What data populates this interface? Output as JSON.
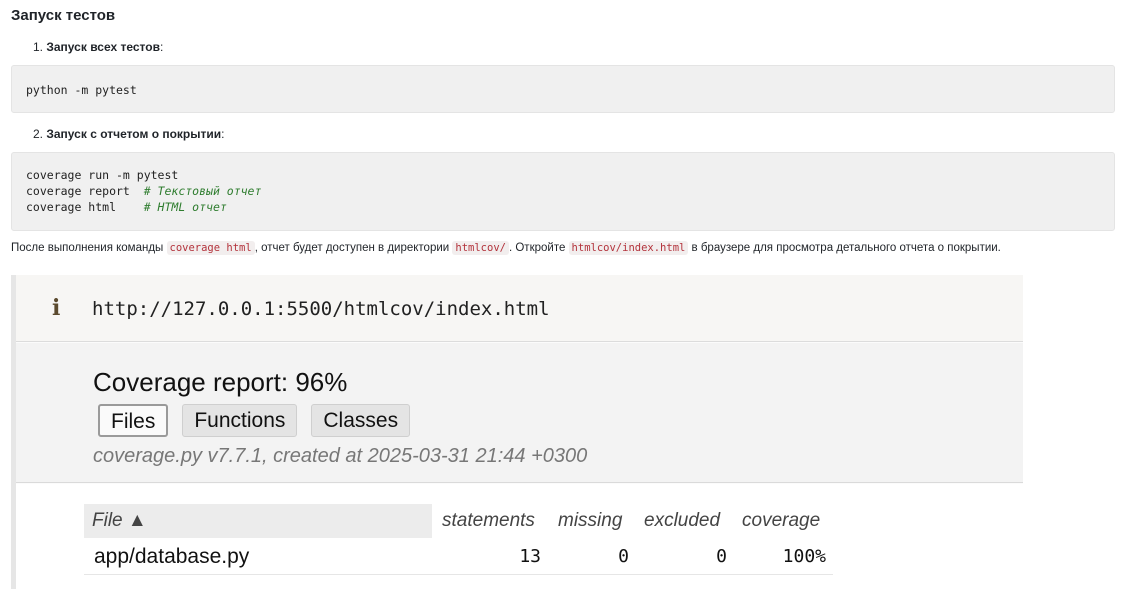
{
  "doc": {
    "title": "Запуск тестов",
    "step1": {
      "num": "1.",
      "text": "Запуск всех тестов",
      "colon": ":"
    },
    "code1": {
      "line1": "python -m pytest"
    },
    "step2": {
      "num": "2.",
      "text": "Запуск с отчетом о покрытии",
      "colon": ":"
    },
    "code2": {
      "lines": [
        {
          "code": "coverage run -m pytest",
          "comment": ""
        },
        {
          "code": "coverage report  ",
          "comment": "# Текстовый отчет"
        },
        {
          "code": "coverage html    ",
          "comment": "# HTML отчет"
        }
      ]
    },
    "paragraph": {
      "p1": "После выполнения команды ",
      "code_a": "coverage html",
      "p2": ", отчет будет доступен в директории ",
      "code_b": "htmlcov/",
      "p3": ". Откройте ",
      "code_c": "htmlcov/index.html",
      "p4": " в браузере для просмотра детального отчета о покрытии."
    }
  },
  "screenshot": {
    "info_icon": "i",
    "url": "http://127.0.0.1:5500/htmlcov/index.html",
    "report_title": "Coverage report: 96%",
    "tabs": [
      "Files",
      "Functions",
      "Classes"
    ],
    "active_tab": "Files",
    "meta": "coverage.py v7.7.1, created at 2025-03-31 21:44 +0300",
    "table": {
      "headers": {
        "file": "File ▲",
        "statements": "statements",
        "missing": "missing",
        "excluded": "excluded",
        "coverage": "coverage"
      },
      "rows": [
        {
          "file": "app/database.py",
          "statements": "13",
          "missing": "0",
          "excluded": "0",
          "coverage": "100%"
        }
      ]
    }
  },
  "colors": {
    "inline_code_text": "#b3323b",
    "comment": "#2f7d2f",
    "code_bg": "#f0f0f0"
  }
}
